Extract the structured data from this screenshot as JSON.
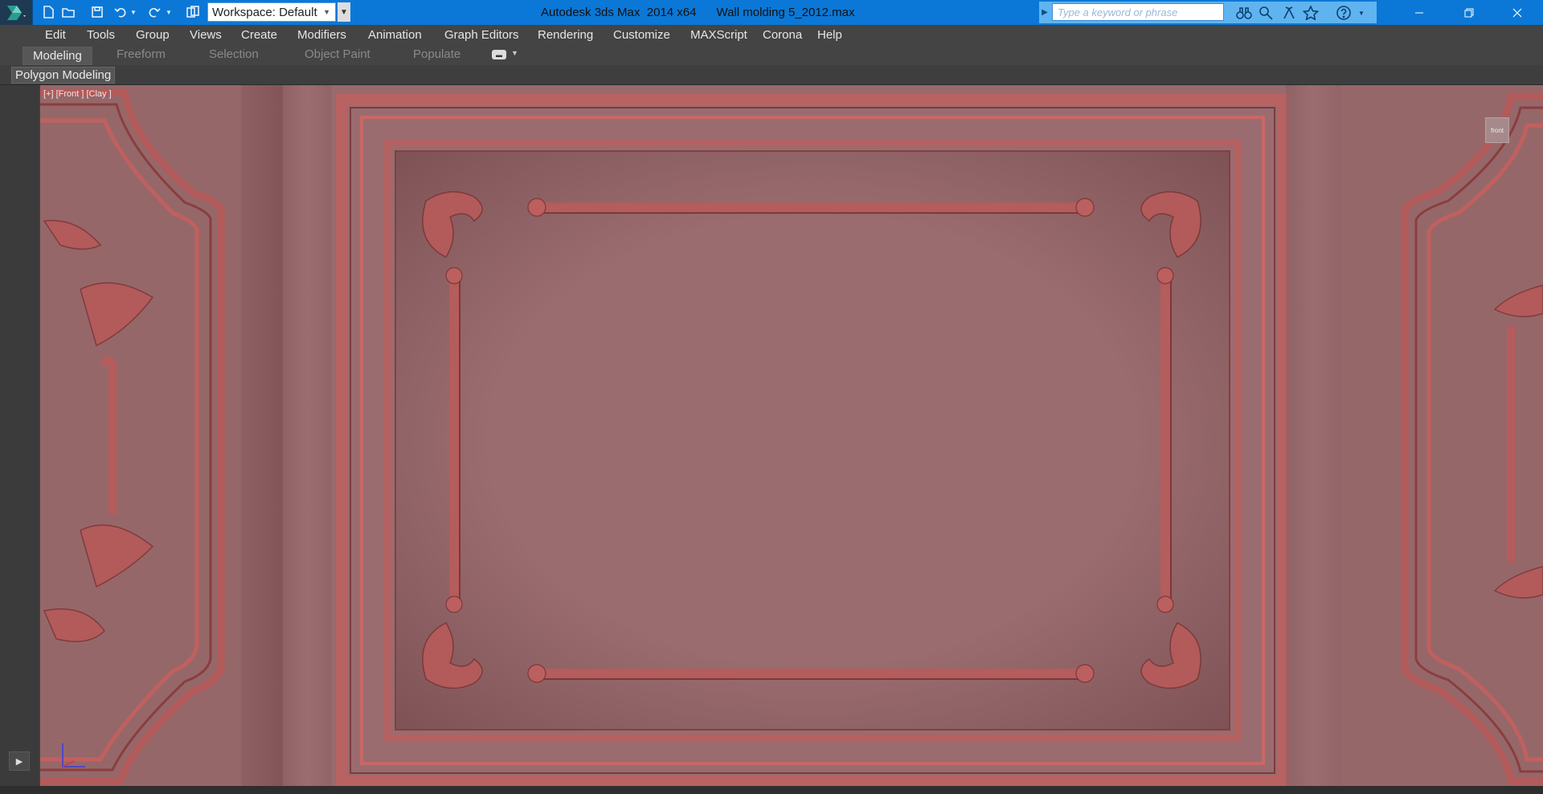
{
  "titlebar": {
    "workspace": "Workspace: Default",
    "app_title": "Autodesk 3ds Max  2014 x64",
    "file_name": "Wall molding 5_2012.max",
    "search_placeholder": "Type a keyword or phrase",
    "accent": "#0b78d7"
  },
  "menu": {
    "items": [
      "Edit",
      "Tools",
      "Group",
      "Views",
      "Create",
      "Modifiers",
      "Animation",
      "Graph Editors",
      "Rendering",
      "Customize",
      "MAXScript",
      "Corona",
      "Help"
    ]
  },
  "ribbon": {
    "tabs": [
      "Modeling",
      "Freeform",
      "Selection",
      "Object Paint",
      "Populate"
    ],
    "active_tab": "Modeling",
    "panel_label": "Polygon Modeling"
  },
  "viewport": {
    "label": "[+] [Front ] [Clay ]",
    "background": "#986a6d",
    "viewcube_label": "front"
  },
  "icons": {
    "app": "3ds-max-logo-icon",
    "new": "new-file-icon",
    "open": "open-folder-icon",
    "save": "save-icon",
    "undo": "undo-icon",
    "redo": "redo-icon",
    "project": "project-folder-icon",
    "binoculars": "binoculars-icon",
    "connect": "connect-icon",
    "subscription": "subscription-icon",
    "favorites": "star-icon",
    "help": "help-icon",
    "minimize": "minimize-icon",
    "restore": "restore-icon",
    "close": "close-icon",
    "play": "play-icon"
  }
}
